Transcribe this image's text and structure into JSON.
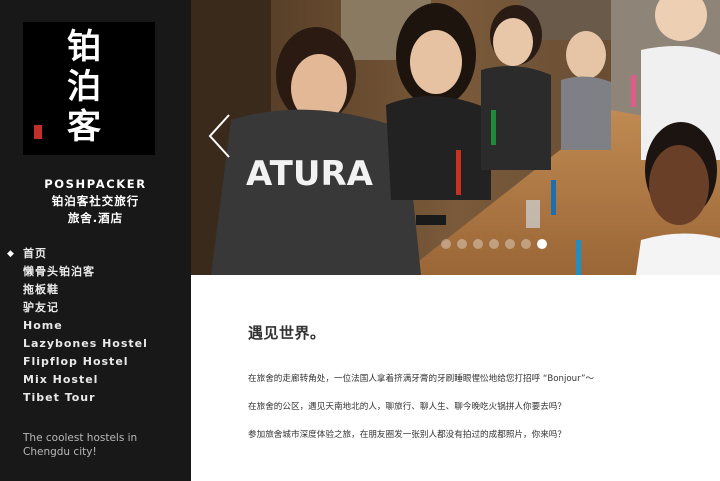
{
  "sidebar": {
    "logo_glyphs": [
      "铂",
      "泊",
      "客"
    ],
    "brand_en": "POSHPACKER",
    "brand_cn_line1": "铂泊客社交旅行",
    "brand_cn_line2": "旅舍.酒店",
    "nav": [
      {
        "label": "首页",
        "active": true
      },
      {
        "label": "懒骨头铂泊客"
      },
      {
        "label": "拖板鞋"
      },
      {
        "label": "驴友记"
      },
      {
        "label": "Home"
      },
      {
        "label": "Lazybones Hostel"
      },
      {
        "label": "Flipflop Hostel"
      },
      {
        "label": "Mix Hostel"
      },
      {
        "label": "Tibet Tour"
      }
    ],
    "tagline": "The coolest hostels in Chengdu city!"
  },
  "hero": {
    "slide_dots": 7,
    "active_dot": 7,
    "shirt_text": "ATURA"
  },
  "content": {
    "heading": "遇见世界。",
    "paragraphs": [
      "在旅舍的走廊转角处，一位法国人拿着挤满牙膏的牙刷睡眼惺忪地给您打招呼 “Bonjour”～",
      "在旅舍的公区，遇见天南地北的人，聊旅行、聊人生、聊今晚吃火锅拼人你要去吗？",
      "参加旅舍城市深度体验之旅，在朋友圈发一张别人都没有拍过的成都照片，你来吗？"
    ]
  },
  "colors": {
    "sidebar_bg": "#181818",
    "logo_bg": "#000000",
    "seal_red": "#c0302b",
    "text_dark": "#333333"
  }
}
